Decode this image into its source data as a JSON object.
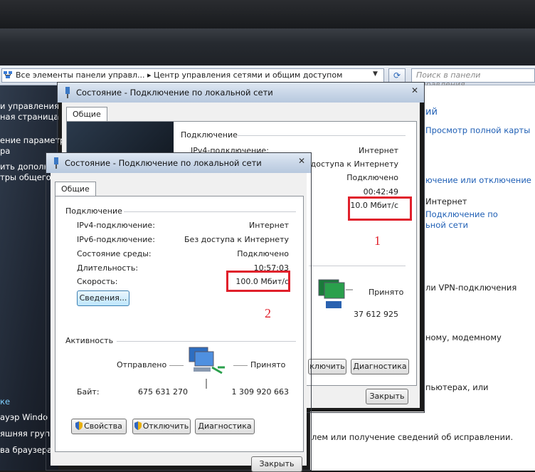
{
  "control_panel": {
    "address": "Все элементы панели управл... ▸ Центр управления сетями и общим доступом",
    "search_placeholder": "Поиск в панели управления",
    "left_items": [
      "и управления -",
      "ная страница",
      "ение параметр",
      "ра",
      "ить дополни",
      "тры общего"
    ],
    "left_bottom": [
      "ке",
      "ауэр Windo",
      "яшняя группа",
      "ва браузера"
    ],
    "right_items": [
      "ий",
      "Просмотр полной карты",
      "ючение или отключение",
      "Интернет",
      "Подключение по",
      "ьной сети",
      "ли VPN-подключения",
      "ному, модемному",
      "пьютерах, или",
      "лем или получение сведений об исправлении."
    ]
  },
  "status1": {
    "title": "Состояние - Подключение по локальной сети",
    "tab": "Общие",
    "group": "Подключение",
    "labels": [
      "IPv4-подключение:"
    ],
    "values": [
      "Интернет",
      "без доступа к Интернету",
      "Подключено",
      "00:42:49",
      "10.0 Мбит/с"
    ],
    "received_label": "Принято",
    "received_value": "37 612 925",
    "disconnect": "ключить",
    "diagnose": "Диагностика",
    "close": "Закрыть"
  },
  "status2": {
    "title": "Состояние - Подключение по локальной сети",
    "tab": "Общие",
    "group_connection": "Подключение",
    "rows": [
      {
        "label": "IPv4-подключение:",
        "value": "Интернет"
      },
      {
        "label": "IPv6-подключение:",
        "value": "Без доступа к Интернету"
      },
      {
        "label": "Состояние среды:",
        "value": "Подключено"
      },
      {
        "label": "Длительность:",
        "value": "10:57:03"
      },
      {
        "label": "Скорость:",
        "value": "100.0 Мбит/с"
      }
    ],
    "details_button": "Сведения...",
    "group_activity": "Активность",
    "sent_label": "Отправлено",
    "received_label": "Принято",
    "bytes_label": "Байт:",
    "bytes_sent": "675 631 270",
    "bytes_received": "1 309 920 663",
    "properties_button": "Свойства",
    "disconnect_button": "Отключить",
    "diagnose_button": "Диагностика",
    "close_button": "Закрыть"
  },
  "annotations": {
    "one": "1",
    "two": "2"
  },
  "colors": {
    "highlight": "#e0202b",
    "link": "#1f5fb5"
  }
}
